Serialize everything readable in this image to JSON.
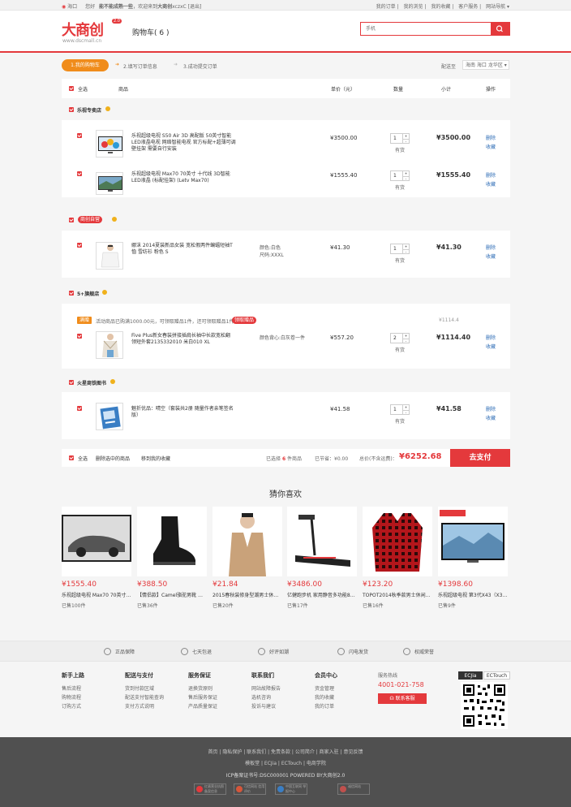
{
  "topbar": {
    "location": "海口",
    "greeting": "您好",
    "welcome": "能不能成熟一些",
    "welcome2": "，欢迎来到",
    "site_name": "大商创",
    "user": "xczxC",
    "logout": "[退出]",
    "links": [
      "我的订单",
      "我的浏览",
      "我的收藏",
      "客户服务",
      "网站导航"
    ]
  },
  "header": {
    "logo": "大商创",
    "logo_ver": "2.0",
    "logo_url": "www.dscmall.cn",
    "cart_title": "购物车",
    "cart_count": "( 6 )",
    "search_placeholder": "手机"
  },
  "steps": {
    "s1": "1.我的购物车",
    "s2": "2.填写订单信息",
    "s3": "3.成功提交订单",
    "region_label": "配送至",
    "region": "海南 海口 龙华区"
  },
  "table_head": {
    "all": "全选",
    "product": "商品",
    "price": "单价（元）",
    "qty": "数量",
    "subtotal": "小计",
    "ops": "操作"
  },
  "shops": [
    {
      "name": "乐视专卖店",
      "items": [
        {
          "title": "乐视超级电视 S50 Air 3D 高配版 50英寸智能LED液晶电视 网络智能电视 官方标配+超薄可调壁挂架 需要自行安装",
          "attr": "",
          "price": "¥3500.00",
          "qty": "1",
          "stock": "有货",
          "subtotal": "¥3500.00"
        },
        {
          "title": "乐视超级电视 Max70 70英寸 十代线 3D智能LED液晶 (标配挂架) (Letv Max70)",
          "attr": "",
          "price": "¥1555.40",
          "qty": "1",
          "stock": "有货",
          "subtotal": "¥1555.40"
        }
      ]
    },
    {
      "name": "商创自营",
      "items": [
        {
          "title": "娜沫 2014夏装新品女装 宽松假两件蝙蝠短袖T恤 雪纺衫 粉色 S",
          "attr": "颜色:白色",
          "attr2": "尺码:XXXL",
          "price": "¥41.30",
          "qty": "1",
          "stock": "有货",
          "subtotal": "¥41.30"
        }
      ]
    },
    {
      "name": "5+旗舰店",
      "promo_tag": "满赠",
      "promo_text": "活动商品已购满1000.00元，可领取赠品1件，还可领取赠品1件",
      "promo_btn": "领取赠品",
      "promo_total": "¥1114.4",
      "items": [
        {
          "title": "Five Plus新女春装拼接插肩长袖中长款宽松翻领短外套2135332010 米白010 XL",
          "attr": "颜色背心:白灰卷一件",
          "price": "¥557.20",
          "qty": "2",
          "stock": "有货",
          "subtotal": "¥1114.40"
        }
      ]
    },
    {
      "name": "火星商铁图书",
      "items": [
        {
          "title": "魅折优品：晴空（套装共2册 随量作者亲笔签名版）",
          "attr": "",
          "price": "¥41.58",
          "qty": "1",
          "stock": "有货",
          "subtotal": "¥41.58"
        }
      ]
    }
  ],
  "ops": {
    "delete": "删除",
    "favorite": "收藏"
  },
  "summary": {
    "all": "全选",
    "del_selected": "删除选中的商品",
    "move_fav": "移到我的收藏",
    "selected_pre": "已选择",
    "selected_count": "6",
    "selected_suf": "件商品",
    "saved_label": "已节省：",
    "saved": "¥0.00",
    "total_label": "总价(不含运费)：",
    "total": "¥6252.68",
    "pay": "去支付"
  },
  "guess": {
    "title": "猜你喜欢",
    "items": [
      {
        "price": "¥1555.40",
        "name": "乐视超级电视 Max70 70英寸 十...",
        "sold": "已售100件"
      },
      {
        "price": "¥388.50",
        "name": "【情侣款】Camel骆驼男靴 时尚...",
        "sold": "已售36件"
      },
      {
        "price": "¥21.84",
        "name": "2015春秋装修身型潮男士休闲韩...",
        "sold": "已售20件"
      },
      {
        "price": "¥3486.00",
        "name": "亿健跑步机 家用静音多功能8008...",
        "sold": "已售17件"
      },
      {
        "price": "¥123.20",
        "name": "TOPOT2014秋季款男士休闲长袖...",
        "sold": "已售16件"
      },
      {
        "price": "¥1398.60",
        "name": "乐视超级电视 第3代X43（X3-43...",
        "sold": "已售9件"
      }
    ]
  },
  "guarantee": [
    "正品保障",
    "七天包退",
    "好评如潮",
    "闪电发货",
    "权威荣誉"
  ],
  "footer_cols": [
    {
      "title": "新手上路",
      "links": [
        "售后流程",
        "购物流程",
        "订购方式"
      ]
    },
    {
      "title": "配送与支付",
      "links": [
        "货到付款区域",
        "配送支付智能查询",
        "支付方式说明"
      ]
    },
    {
      "title": "服务保证",
      "links": [
        "退换货原则",
        "售后服务保证",
        "产品质量保证"
      ]
    },
    {
      "title": "联系我们",
      "links": [
        "网站故障报告",
        "选机咨询",
        "投诉与建议"
      ]
    },
    {
      "title": "会员中心",
      "links": [
        "资金管理",
        "我的收藏",
        "我的订单"
      ]
    }
  ],
  "hotline": {
    "label": "服务热线",
    "number": "4001-021-758",
    "btn": "联系客服"
  },
  "qr_tabs": [
    "ECJia",
    "ECTouch"
  ],
  "bottom": {
    "links": "首页 | 隐私保护 | 联系我们 | 免责条款 | 公司简介 | 商家入驻 | 意见反馈",
    "links2": "模板堂 | ECJia | ECTouch | 电商学院",
    "icp": "ICP备案证书号:DSC000001 POWERED BY大商创2.0",
    "badges": [
      "红盾营业执照 备案信息",
      "可信网站 信用评价",
      "中国互联网 举报中心",
      "诚信网站"
    ]
  }
}
